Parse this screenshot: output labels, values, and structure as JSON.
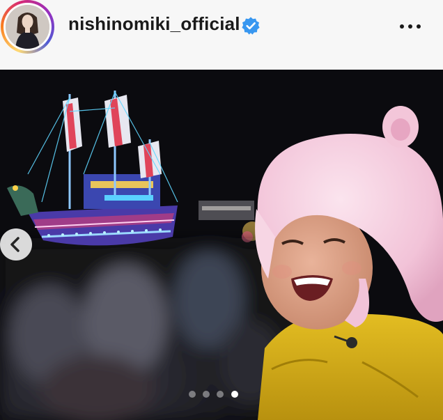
{
  "header": {
    "username": "nishinomiki_official",
    "verified": true,
    "verified_icon": "verified-badge-icon",
    "more_icon": "more-options-icon"
  },
  "carousel": {
    "current_slide": 4,
    "total_slides": 4,
    "prev_icon": "chevron-left-icon"
  },
  "colors": {
    "verified_blue": "#3897f0",
    "jacket_yellow": "#d9b21a",
    "hat_pink": "#f4c9dc"
  }
}
